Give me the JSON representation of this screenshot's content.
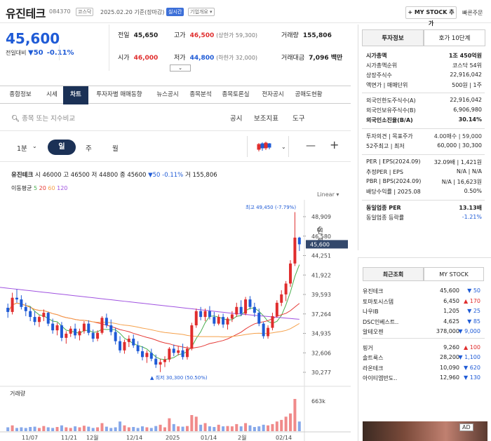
{
  "header": {
    "title": "유진테크",
    "code": "084370",
    "market": "코스닥",
    "date": "2025.02.20",
    "basis": "기준(장마감)",
    "realtime": "실시간",
    "overview": "기업개요",
    "mystock": "+ MY STOCK 추가",
    "quick": "빠른주문"
  },
  "quote": {
    "price": "45,600",
    "diff_label": "전일대비",
    "diff_val": "50",
    "pct": "-0.11%",
    "prev_l": "전일",
    "prev_v": "45,650",
    "high_l": "고가",
    "high_v": "46,500",
    "high_s": "(상한가 59,300)",
    "vol_l": "거래량",
    "vol_v": "155,806",
    "open_l": "시가",
    "open_v": "46,000",
    "low_l": "저가",
    "low_v": "44,800",
    "low_s": "(하한가 32,000)",
    "amt_l": "거래대금",
    "amt_v": "7,096 백만"
  },
  "tabs": [
    "종합정보",
    "시세",
    "차트",
    "투자자별 매매동향",
    "뉴스공시",
    "종목분석",
    "종목토론실",
    "전자공시",
    "공매도현황"
  ],
  "toolbar": {
    "search_ph": "종목 또는 지수비교",
    "t1": "공시",
    "t2": "보조지표",
    "t3": "도구",
    "t4": "인쇄"
  },
  "period": {
    "p1": "1분",
    "p2": "일",
    "p3": "주",
    "p4": "월"
  },
  "summary": {
    "name": "유진테크",
    "o_l": "시",
    "o": "46000",
    "h_l": "고",
    "h": "46500",
    "l_l": "저",
    "l": "44800",
    "c_l": "종",
    "c": "45600",
    "d": "▼50",
    "pct": "-0.11%",
    "v_l": "거",
    "v": "155,806"
  },
  "ma": {
    "label": "이동평균",
    "m5": "5",
    "m20": "20",
    "m60": "60",
    "m120": "120",
    "c5": "#4caf50",
    "c20": "#e53935",
    "c60": "#f5a04a",
    "c120": "#a052e0"
  },
  "chart_data": {
    "type": "candlestick",
    "scale": "Linear",
    "y_ticks": [
      "48,909",
      "46,580",
      "44,251",
      "41,922",
      "39,593",
      "37,264",
      "34,935",
      "32,606",
      "30,277"
    ],
    "x_ticks": [
      "11/07",
      "11/21",
      "12월",
      "12/14",
      "2025",
      "01/14",
      "2월",
      "02/14"
    ],
    "last": "45,600",
    "max_label": "최고 49,450 (-7.79%)",
    "min_label": "최저 30,300 (50.50%)",
    "volume_label": "거래량",
    "volume_max": "663k",
    "ohlc": [
      [
        38000,
        38500,
        36800,
        37500
      ],
      [
        37500,
        39800,
        37200,
        39200
      ],
      [
        39200,
        40200,
        38600,
        39000
      ],
      [
        39000,
        39500,
        37800,
        38100
      ],
      [
        38100,
        38600,
        37000,
        37600
      ],
      [
        37600,
        38100,
        36400,
        36900
      ],
      [
        36900,
        37600,
        35900,
        36300
      ],
      [
        36300,
        37100,
        35700,
        36900
      ],
      [
        36900,
        37800,
        36400,
        37400
      ],
      [
        37400,
        37500,
        35800,
        36100
      ],
      [
        36100,
        36700,
        34900,
        35300
      ],
      [
        35300,
        36200,
        34700,
        35900
      ],
      [
        35900,
        36300,
        34000,
        34400
      ],
      [
        34400,
        35200,
        33700,
        34900
      ],
      [
        34900,
        35800,
        34500,
        35500
      ],
      [
        35500,
        36100,
        34300,
        34700
      ],
      [
        34700,
        35500,
        34100,
        35200
      ],
      [
        35200,
        36400,
        34900,
        36100
      ],
      [
        36100,
        36500,
        34700,
        35000
      ],
      [
        35000,
        35400,
        33900,
        34300
      ],
      [
        34300,
        35300,
        34000,
        35000
      ],
      [
        35000,
        37000,
        34800,
        36800
      ],
      [
        36800,
        37300,
        35600,
        35900
      ],
      [
        35900,
        36600,
        34700,
        35100
      ],
      [
        35100,
        35600,
        33600,
        34000
      ],
      [
        34000,
        34600,
        32600,
        32900
      ],
      [
        32900,
        34200,
        32500,
        33900
      ],
      [
        33900,
        34700,
        33300,
        34300
      ],
      [
        34300,
        34800,
        33200,
        33500
      ],
      [
        33500,
        34000,
        32500,
        32800
      ],
      [
        32800,
        33400,
        31700,
        32100
      ],
      [
        32100,
        32900,
        31400,
        32600
      ],
      [
        32600,
        33100,
        31600,
        31900
      ],
      [
        31900,
        32400,
        30800,
        31200
      ],
      [
        31200,
        31900,
        30300,
        31500
      ],
      [
        31500,
        32200,
        30900,
        31800
      ],
      [
        31800,
        33300,
        31500,
        33100
      ],
      [
        33100,
        33600,
        32200,
        32600
      ],
      [
        32600,
        33400,
        32300,
        32900
      ],
      [
        32900,
        33700,
        31800,
        32100
      ],
      [
        32100,
        33400,
        31800,
        33100
      ],
      [
        33100,
        36200,
        32900,
        35900
      ],
      [
        35900,
        37900,
        35600,
        37600
      ],
      [
        37600,
        38100,
        36500,
        36900
      ],
      [
        36900,
        37900,
        36400,
        37600
      ],
      [
        37600,
        38200,
        36600,
        36900
      ],
      [
        36900,
        37500,
        35800,
        36100
      ],
      [
        36100,
        37200,
        35900,
        36900
      ],
      [
        36900,
        37300,
        35600,
        36000
      ],
      [
        36000,
        36900,
        35400,
        36700
      ],
      [
        36700,
        37600,
        36300,
        37200
      ],
      [
        37200,
        38600,
        36900,
        38100
      ],
      [
        38100,
        38900,
        37000,
        37300
      ],
      [
        37300,
        39300,
        37100,
        39000
      ],
      [
        39000,
        39400,
        37800,
        38100
      ],
      [
        38100,
        38600,
        36900,
        37400
      ],
      [
        37400,
        37900,
        35800,
        36100
      ],
      [
        36100,
        36300,
        34300,
        34600
      ],
      [
        34600,
        35900,
        34300,
        35600
      ],
      [
        35600,
        37400,
        35300,
        37000
      ],
      [
        37000,
        38900,
        36800,
        38600
      ],
      [
        38600,
        40100,
        38200,
        39600
      ],
      [
        39600,
        41200,
        38800,
        40900
      ],
      [
        40900,
        43700,
        40500,
        43300
      ],
      [
        43300,
        49450,
        43000,
        46400
      ],
      [
        46400,
        46500,
        44800,
        45600
      ]
    ],
    "volume": [
      0.12,
      0.18,
      0.1,
      0.12,
      0.1,
      0.13,
      0.14,
      0.1,
      0.16,
      0.12,
      0.1,
      0.13,
      0.18,
      0.12,
      0.1,
      0.15,
      0.12,
      0.17,
      0.14,
      0.1,
      0.12,
      0.25,
      0.14,
      0.1,
      0.12,
      0.3,
      0.18,
      0.12,
      0.13,
      0.1,
      0.15,
      0.12,
      0.1,
      0.16,
      0.2,
      0.12,
      0.4,
      0.22,
      0.15,
      0.14,
      0.16,
      0.5,
      0.45,
      0.2,
      0.25,
      0.15,
      0.13,
      0.2,
      0.15,
      0.16,
      0.15,
      0.22,
      0.15,
      0.25,
      0.18,
      0.13,
      0.15,
      0.2,
      0.18,
      0.22,
      0.3,
      0.35,
      0.45,
      0.55,
      1.0,
      0.3
    ]
  },
  "invest": {
    "tab1": "투자정보",
    "tab2": "호가 10단계",
    "rows": [
      [
        "시가총액",
        "1조 450억원"
      ],
      [
        "시가총액순위",
        "코스닥 54위"
      ],
      [
        "상장주식수",
        "22,916,042"
      ],
      [
        "액면가 | 매매단위",
        "500원 | 1주"
      ],
      [
        "외국인한도주식수(A)",
        "22,916,042"
      ],
      [
        "외국인보유주식수(B)",
        "6,906,980"
      ],
      [
        "외국인소진율(B/A)",
        "30.14%"
      ],
      [
        "투자의견 | 목표주가",
        "4.00매수 | 59,000"
      ],
      [
        "52주최고 | 최저",
        "60,000 | 30,300"
      ],
      [
        "PER | EPS(2024.09)",
        "32.09배 | 1,421원"
      ],
      [
        "추정PER | EPS",
        "N/A | N/A"
      ],
      [
        "PBR | BPS(2024.09)",
        "N/A | 16,623원"
      ],
      [
        "배당수익률 | 2025.08",
        "0.50%"
      ],
      [
        "동일업종 PER",
        "13.13배"
      ],
      [
        "동일업종 등락률",
        "-1.21%"
      ]
    ]
  },
  "recent": {
    "tab1": "최근조회",
    "tab2": "MY STOCK",
    "items": [
      [
        "유진테크",
        "45,600",
        "▼ 50",
        "down"
      ],
      [
        "토마토시스템",
        "6,450",
        "▲ 170",
        "up"
      ],
      [
        "나우IB",
        "1,205",
        "▼ 25",
        "down"
      ],
      [
        "DSC인베스트..",
        "4,625",
        "▼ 85",
        "down"
      ],
      [
        "알테오젠",
        "378,000",
        "▼ 9,000",
        "down"
      ],
      [
        "핑거",
        "9,260",
        "▲ 100",
        "up"
      ],
      [
        "솔트룩스",
        "28,200",
        "▼ 1,100",
        "down"
      ],
      [
        "라온테크",
        "10,090",
        "▼ 620",
        "down"
      ],
      [
        "아이티엠반도..",
        "12,960",
        "▼ 130",
        "down"
      ]
    ]
  },
  "ad": "AD"
}
